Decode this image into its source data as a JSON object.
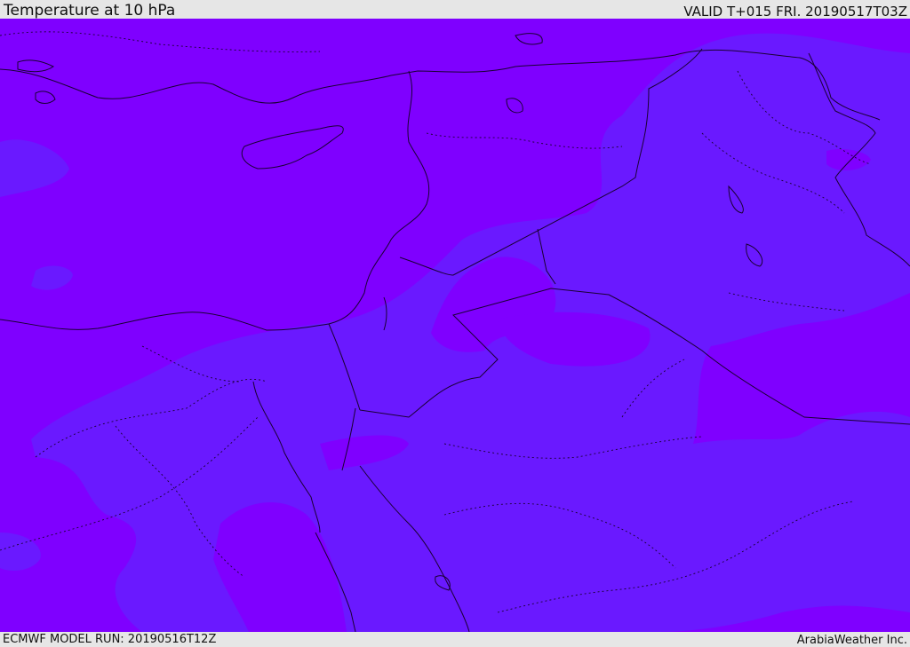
{
  "header": {
    "title": "Temperature at 10 hPa",
    "valid": "VALID T+015 FRI. 20190517T03Z"
  },
  "footer": {
    "model_run": "ECMWF MODEL RUN: 20190516T12Z",
    "credit": "ArabiaWeather Inc."
  },
  "colors": {
    "field_warm": "#7f00ff",
    "field_cool": "#6a19ff",
    "boundary": "#1a0033",
    "bar_background": "#e6e6e6"
  },
  "legend": {
    "field": "temperature at 10 hPa",
    "shading": "two temperature bands (violet and blue-violet)"
  }
}
